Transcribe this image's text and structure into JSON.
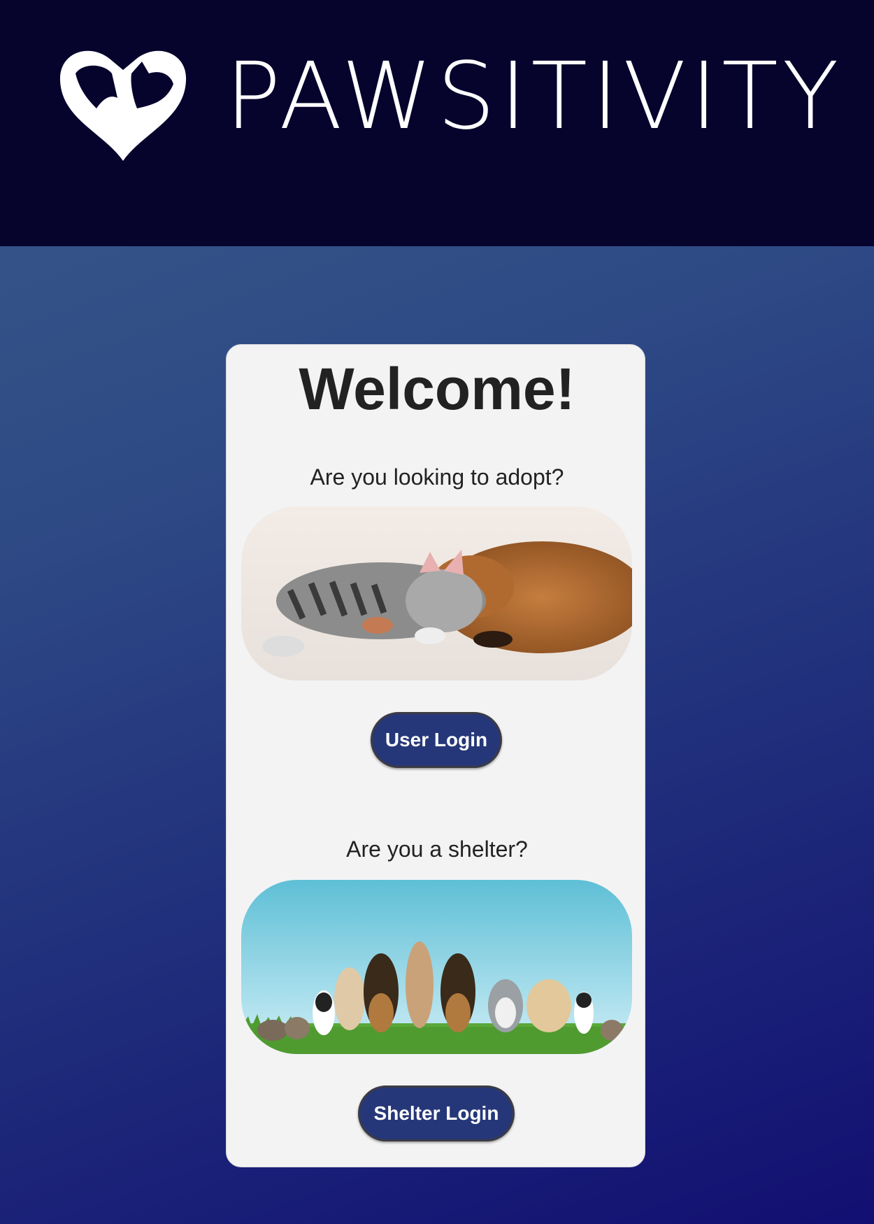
{
  "header": {
    "brand_name": "PAWSITIVITY",
    "logo_icon": "cat-dog-heart-logo-icon",
    "background": "#06032d"
  },
  "card": {
    "title": "Welcome!",
    "adopt_section": {
      "prompt": "Are you looking to adopt?",
      "image": "sleeping-kitten-and-puppy-photo",
      "button_label": "User Login"
    },
    "shelter_section": {
      "prompt": "Are you a shelter?",
      "image": "group-of-dogs-and-cats-on-grass-photo",
      "button_label": "Shelter Login"
    }
  },
  "colors": {
    "button": "#263779",
    "card": "#f3f3f4",
    "page_gradient_start": "#3a5a8a",
    "page_gradient_end": "#120f72"
  }
}
